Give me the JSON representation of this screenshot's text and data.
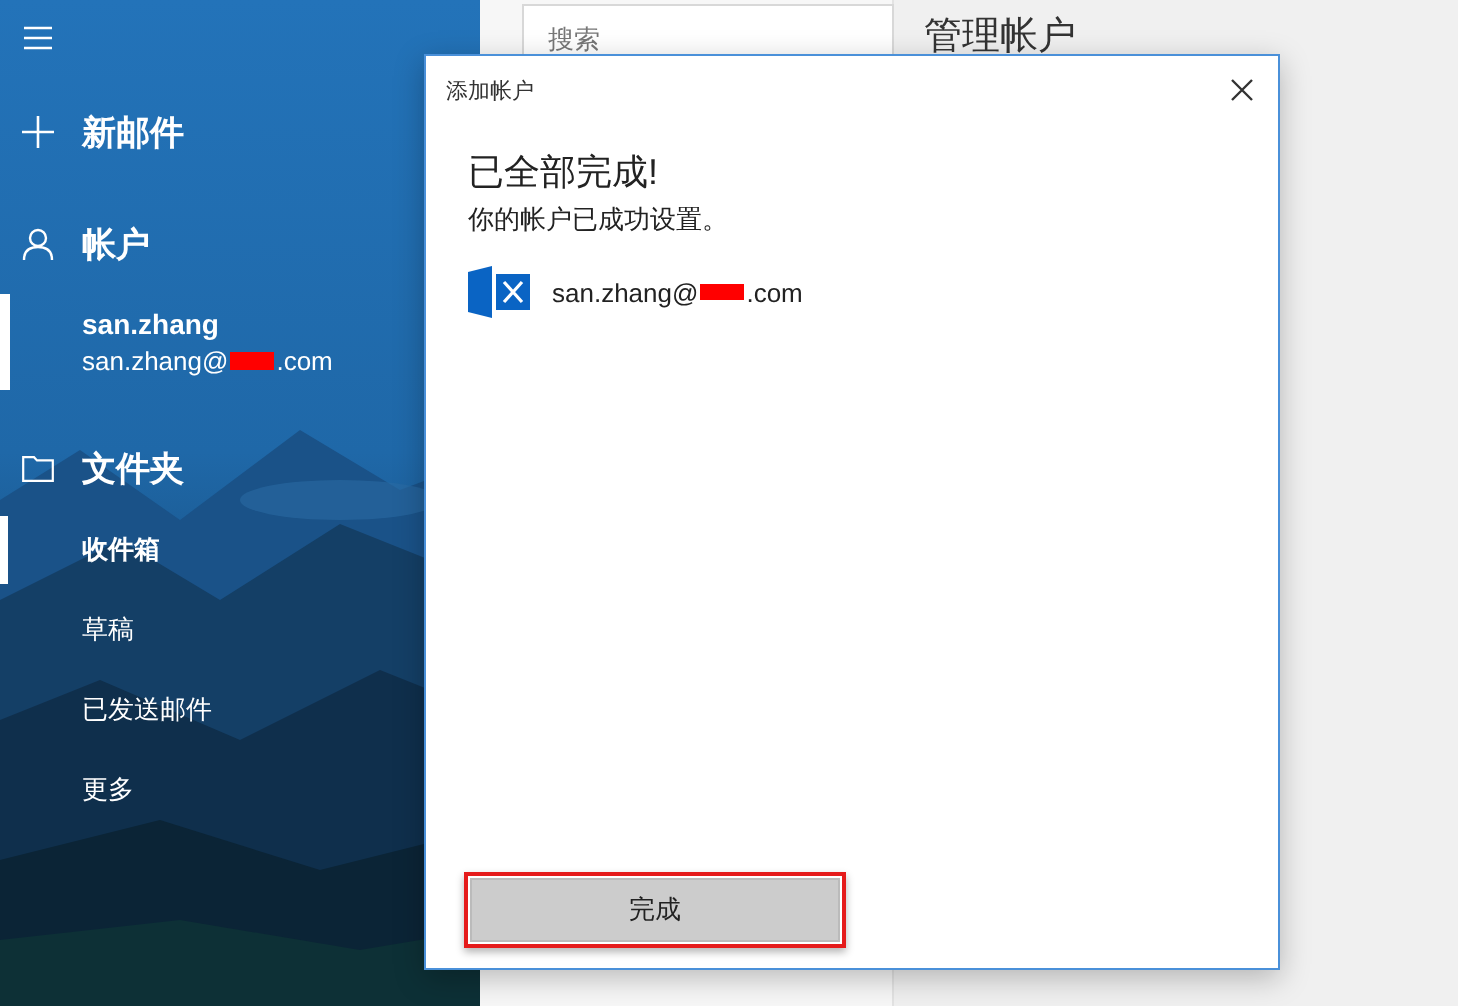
{
  "sidebar": {
    "new_mail": "新邮件",
    "accounts_heading": "帐户",
    "accounts": [
      {
        "name": "san.zhang",
        "email_start": "san.zhang@",
        "email_end": ".com",
        "selected": true
      }
    ],
    "folders_heading": "文件夹",
    "folders": [
      {
        "label": "收件箱",
        "selected": true
      },
      {
        "label": "草稿",
        "selected": false
      },
      {
        "label": "已发送邮件",
        "selected": false
      },
      {
        "label": "更多",
        "selected": false
      }
    ]
  },
  "search": {
    "placeholder": "搜索"
  },
  "page_title": "管理帐户",
  "dialog": {
    "title": "添加帐户",
    "heading": "已全部完成!",
    "message": "你的帐户已成功设置。",
    "account": {
      "email_start": "san.zhang@",
      "email_end": ".com"
    },
    "done_button": "完成"
  }
}
